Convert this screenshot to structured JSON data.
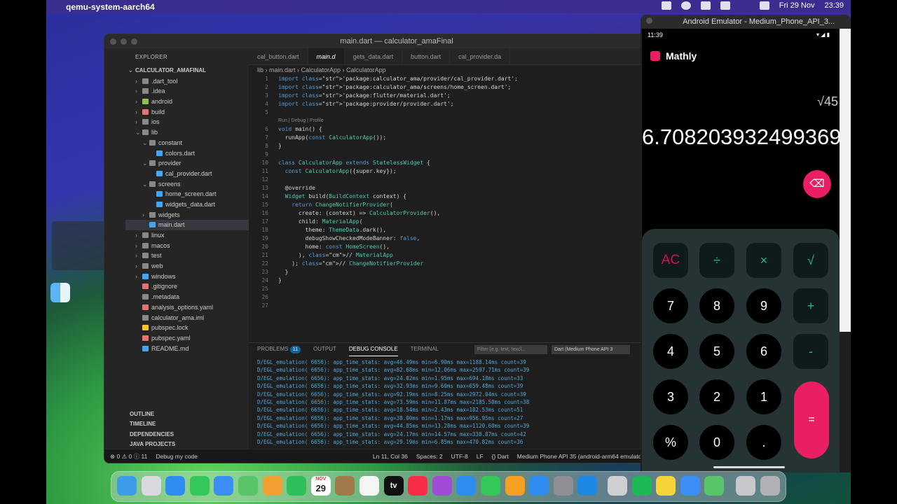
{
  "menubar": {
    "app": "qemu-system-aarch64",
    "date": "Fri 29 Nov",
    "time": "23:39"
  },
  "vscode": {
    "title": "main.dart — calculator_amaFinal",
    "explorer_label": "EXPLORER",
    "root": "CALCULATOR_AMAFINAL",
    "tree": [
      {
        "name": ".dart_tool",
        "indent": 1,
        "twig": "›",
        "color": "#888"
      },
      {
        "name": ".idea",
        "indent": 1,
        "twig": "›",
        "color": "#888"
      },
      {
        "name": "android",
        "indent": 1,
        "twig": "›",
        "color": "#8bc34a"
      },
      {
        "name": "build",
        "indent": 1,
        "twig": "›",
        "color": "#e57373"
      },
      {
        "name": "ios",
        "indent": 1,
        "twig": "›",
        "color": "#888"
      },
      {
        "name": "lib",
        "indent": 1,
        "twig": "⌄",
        "color": "#888"
      },
      {
        "name": "constant",
        "indent": 2,
        "twig": "⌄",
        "color": "#888"
      },
      {
        "name": "colors.dart",
        "indent": 3,
        "twig": "",
        "color": "#42a5f5"
      },
      {
        "name": "provider",
        "indent": 2,
        "twig": "⌄",
        "color": "#888"
      },
      {
        "name": "cal_provider.dart",
        "indent": 3,
        "twig": "",
        "color": "#42a5f5"
      },
      {
        "name": "screens",
        "indent": 2,
        "twig": "⌄",
        "color": "#888"
      },
      {
        "name": "home_screen.dart",
        "indent": 3,
        "twig": "",
        "color": "#42a5f5"
      },
      {
        "name": "widgets_data.dart",
        "indent": 3,
        "twig": "",
        "color": "#42a5f5"
      },
      {
        "name": "widgets",
        "indent": 2,
        "twig": "›",
        "color": "#888"
      },
      {
        "name": "main.dart",
        "indent": 2,
        "twig": "",
        "color": "#42a5f5",
        "selected": true
      },
      {
        "name": "linux",
        "indent": 1,
        "twig": "›",
        "color": "#888"
      },
      {
        "name": "macos",
        "indent": 1,
        "twig": "›",
        "color": "#888"
      },
      {
        "name": "test",
        "indent": 1,
        "twig": "›",
        "color": "#888"
      },
      {
        "name": "web",
        "indent": 1,
        "twig": "›",
        "color": "#888"
      },
      {
        "name": "windows",
        "indent": 1,
        "twig": "›",
        "color": "#42a5f5"
      },
      {
        "name": ".gitignore",
        "indent": 1,
        "twig": "",
        "color": "#e57373"
      },
      {
        "name": ".metadata",
        "indent": 1,
        "twig": "",
        "color": "#888"
      },
      {
        "name": "analysis_options.yaml",
        "indent": 1,
        "twig": "",
        "color": "#e57373"
      },
      {
        "name": "calculator_ama.iml",
        "indent": 1,
        "twig": "",
        "color": "#888"
      },
      {
        "name": "pubspec.lock",
        "indent": 1,
        "twig": "",
        "color": "#fbc02d"
      },
      {
        "name": "pubspec.yaml",
        "indent": 1,
        "twig": "",
        "color": "#e57373"
      },
      {
        "name": "README.md",
        "indent": 1,
        "twig": "",
        "color": "#42a5f5"
      }
    ],
    "sections": [
      "OUTLINE",
      "TIMELINE",
      "DEPENDENCIES",
      "JAVA PROJECTS"
    ],
    "tabs": [
      "cal_button.dart",
      "main.d",
      "gets_data.dart",
      "button.dart",
      "cal_provider.da"
    ],
    "breadcrumb": "lib › main.dart › CalculatorApp › CalculatorApp",
    "codelens": "Run | Debug | Profile",
    "code": [
      [
        "1",
        "import 'package:calculator_ama/provider/cal_provider.dart';"
      ],
      [
        "2",
        "import 'package:calculator_ama/screens/home_screen.dart';"
      ],
      [
        "3",
        "import 'package:flutter/material.dart';"
      ],
      [
        "4",
        "import 'package:provider/provider.dart';"
      ],
      [
        "5",
        ""
      ],
      [
        "6",
        "void main() {"
      ],
      [
        "7",
        "  runApp(const CalculatorApp());"
      ],
      [
        "8",
        "}"
      ],
      [
        "9",
        ""
      ],
      [
        "10",
        "class CalculatorApp extends StatelessWidget {"
      ],
      [
        "11",
        "  const CalculatorApp({super.key});"
      ],
      [
        "12",
        ""
      ],
      [
        "13",
        "  @override"
      ],
      [
        "14",
        "  Widget build(BuildContext context) {"
      ],
      [
        "15",
        "    return ChangeNotifierProvider("
      ],
      [
        "16",
        "      create: (context) => CalculatorProvider(),"
      ],
      [
        "17",
        "      child: MaterialApp("
      ],
      [
        "18",
        "        theme: ThemeData.dark(),"
      ],
      [
        "19",
        "        debugShowCheckedModeBanner: false,"
      ],
      [
        "20",
        "        home: const HomeScreen(),"
      ],
      [
        "21",
        "      ), // MaterialApp"
      ],
      [
        "22",
        "    ); // ChangeNotifierProvider"
      ],
      [
        "23",
        "  }"
      ],
      [
        "24",
        "}"
      ],
      [
        "25",
        ""
      ],
      [
        "26",
        ""
      ],
      [
        "27",
        ""
      ]
    ],
    "panel": {
      "problems": "PROBLEMS",
      "problems_count": "11",
      "output": "OUTPUT",
      "debug": "DEBUG CONSOLE",
      "terminal": "TERMINAL",
      "filter": "Filter (e.g. text, !excl...",
      "device": "Dart (Medium Phone API 3"
    },
    "logs": [
      "D/EGL_emulation( 6656): app_time_stats: avg=46.49ms min=6.90ms max=1188.14ms count=39",
      "D/EGL_emulation( 6656): app_time_stats: avg=82.68ms min=12.06ms max=2597.71ms count=39",
      "D/EGL_emulation( 6656): app_time_stats: avg=24.02ms min=1.95ms max=694.18ms count=33",
      "D/EGL_emulation( 6656): app_time_stats: avg=32.93ms min=9.60ms max=659.48ms count=39",
      "D/EGL_emulation( 6656): app_time_stats: avg=92.19ms min=8.25ms max=2972.04ms count=39",
      "D/EGL_emulation( 6656): app_time_stats: avg=73.59ms min=11.87ms max=2185.50ms count=38",
      "D/EGL_emulation( 6656): app_time_stats: avg=18.54ms min=2.43ms max=182.53ms count=51",
      "D/EGL_emulation( 6656): app_time_stats: avg=38.00ms min=1.17ms max=956.95ms count=27",
      "D/EGL_emulation( 6656): app_time_stats: avg=44.85ms min=13.28ms max=1120.60ms count=39",
      "D/EGL_emulation( 6656): app_time_stats: avg=24.17ms min=14.57ms max=338.87ms count=42",
      "D/EGL_emulation( 6656): app_time_stats: avg=29.19ms min=6.85ms max=470.82ms count=36"
    ],
    "status": {
      "errors": "⊗ 0 ⚠ 0 ⓘ 11",
      "debug": "Debug my code",
      "pos": "Ln 11, Col 36",
      "spaces": "Spaces: 2",
      "enc": "UTF-8",
      "eol": "LF",
      "lang": "{} Dart",
      "device": "Medium Phone API 35 (android-arm64 emulator)"
    }
  },
  "emulator": {
    "title": "Android Emulator - Medium_Phone_API_3...",
    "phone_time": "11:39",
    "app_name": "Mathly",
    "expression": "√45",
    "result": "6.708203932499369",
    "backspace": "⌫",
    "keys": [
      {
        "label": "AC",
        "kind": "ac"
      },
      {
        "label": "÷",
        "kind": "op"
      },
      {
        "label": "×",
        "kind": "op"
      },
      {
        "label": "√",
        "kind": "op"
      },
      {
        "label": "7",
        "kind": "round"
      },
      {
        "label": "8",
        "kind": "round"
      },
      {
        "label": "9",
        "kind": "round"
      },
      {
        "label": "+",
        "kind": "op"
      },
      {
        "label": "4",
        "kind": "round"
      },
      {
        "label": "5",
        "kind": "round"
      },
      {
        "label": "6",
        "kind": "round"
      },
      {
        "label": "-",
        "kind": "op"
      },
      {
        "label": "3",
        "kind": "round"
      },
      {
        "label": "2",
        "kind": "round"
      },
      {
        "label": "1",
        "kind": "round"
      },
      {
        "label": "%",
        "kind": "round"
      },
      {
        "label": "0",
        "kind": "round"
      },
      {
        "label": ".",
        "kind": "round"
      }
    ],
    "equals": "="
  },
  "dock": [
    {
      "name": "finder",
      "color": "#3d9be9"
    },
    {
      "name": "launchpad",
      "color": "#d9d9e0"
    },
    {
      "name": "safari",
      "color": "#2f8cf0"
    },
    {
      "name": "messages",
      "color": "#34c759"
    },
    {
      "name": "mail",
      "color": "#3a8ef6"
    },
    {
      "name": "maps",
      "color": "#5ac46a"
    },
    {
      "name": "photos",
      "color": "#f0a030"
    },
    {
      "name": "facetime",
      "color": "#2fbf5a"
    },
    {
      "name": "calendar",
      "color": "#ffffff"
    },
    {
      "name": "notes-brown",
      "color": "#a07a4a"
    },
    {
      "name": "reminders",
      "color": "#f5f5f5"
    },
    {
      "name": "appletv",
      "color": "#111111"
    },
    {
      "name": "music",
      "color": "#fa2d48"
    },
    {
      "name": "podcasts",
      "color": "#a24bd6"
    },
    {
      "name": "keynote",
      "color": "#2f8cf0"
    },
    {
      "name": "numbers",
      "color": "#34c759"
    },
    {
      "name": "pages",
      "color": "#f5a020"
    },
    {
      "name": "appstore",
      "color": "#2f8cf0"
    },
    {
      "name": "settings",
      "color": "#8e8e93"
    },
    {
      "name": "vscode",
      "color": "#1e88e5"
    },
    {
      "name": "editor",
      "color": "#d0d0d0"
    },
    {
      "name": "spotify",
      "color": "#1db954"
    },
    {
      "name": "notes",
      "color": "#f7d33a"
    },
    {
      "name": "utm",
      "color": "#3a8ef6"
    },
    {
      "name": "android-emulator",
      "color": "#5ac46a"
    },
    {
      "name": "printer",
      "color": "#c7c7cc"
    },
    {
      "name": "trash",
      "color": "#b0b0b5"
    }
  ],
  "dock_labels": {
    "calendar_month": "NOV",
    "calendar_day": "29",
    "tv": "tv"
  }
}
